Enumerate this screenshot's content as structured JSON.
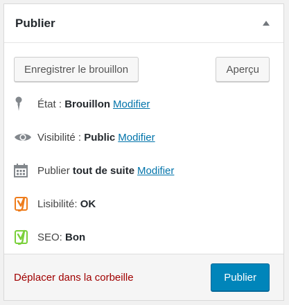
{
  "box": {
    "title": "Publier"
  },
  "buttons": {
    "save_draft": "Enregistrer le brouillon",
    "preview": "Aperçu",
    "publish": "Publier"
  },
  "status": {
    "label": "État :",
    "value": "Brouillon",
    "edit": "Modifier",
    "icon": "pin-icon"
  },
  "visibility": {
    "label": "Visibilité :",
    "value": "Public",
    "edit": "Modifier",
    "icon": "eye-icon"
  },
  "schedule": {
    "label": "Publier",
    "value": "tout de suite",
    "edit": "Modifier",
    "icon": "calendar-icon"
  },
  "readability": {
    "label": "Lisibilité:",
    "value": "OK",
    "icon": "yoast-orange-icon",
    "color": "#ee7c1b"
  },
  "seo": {
    "label": "SEO:",
    "value": "Bon",
    "icon": "yoast-green-icon",
    "color": "#7ad03a"
  },
  "trash_link": "Déplacer dans la corbeille",
  "colors": {
    "link": "#0073aa",
    "primary": "#0085ba",
    "danger": "#a00000"
  }
}
